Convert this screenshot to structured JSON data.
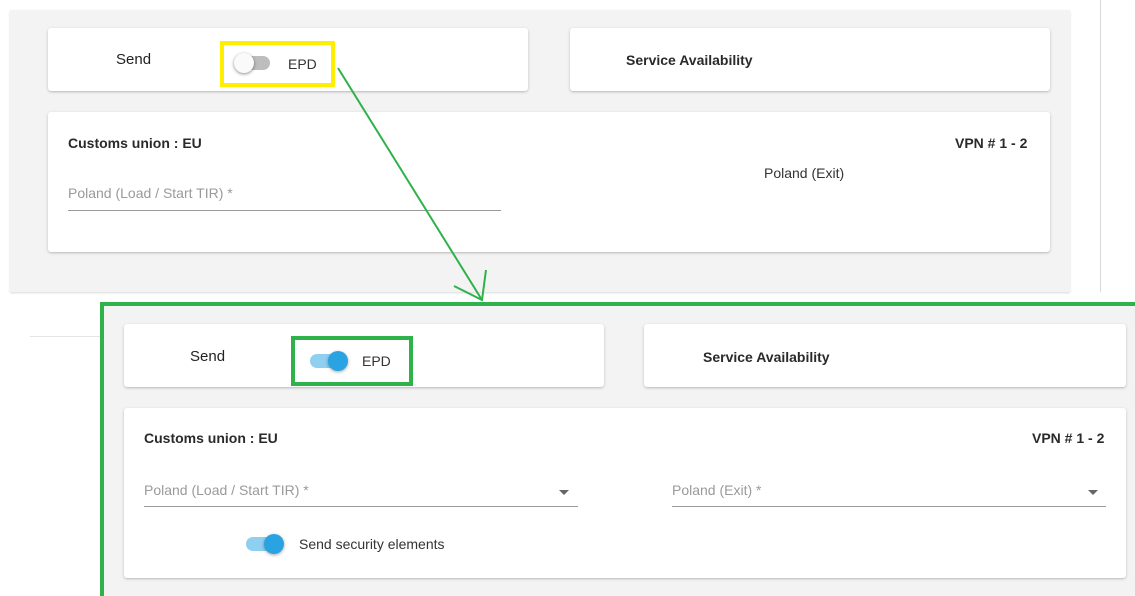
{
  "before": {
    "send_label": "Send",
    "epd_label": "EPD",
    "service_availability": "Service Availability",
    "customs_union": "Customs union : EU",
    "vpn": "VPN # 1 - 2",
    "start_placeholder": "Poland (Load / Start TIR) *",
    "exit_label": "Poland (Exit)",
    "epd_toggle_state": "off"
  },
  "after": {
    "send_label": "Send",
    "epd_label": "EPD",
    "service_availability": "Service Availability",
    "customs_union": "Customs union : EU",
    "vpn": "VPN # 1 - 2",
    "start_placeholder": "Poland (Load / Start TIR) *",
    "exit_placeholder": "Poland (Exit) *",
    "security_label": "Send security elements",
    "epd_toggle_state": "on",
    "security_toggle_state": "on"
  },
  "colors": {
    "highlight_before": "#ffee00",
    "highlight_after": "#2eb24a",
    "arrow": "#2eb24a",
    "toggle_on": "#2aa3e3"
  }
}
